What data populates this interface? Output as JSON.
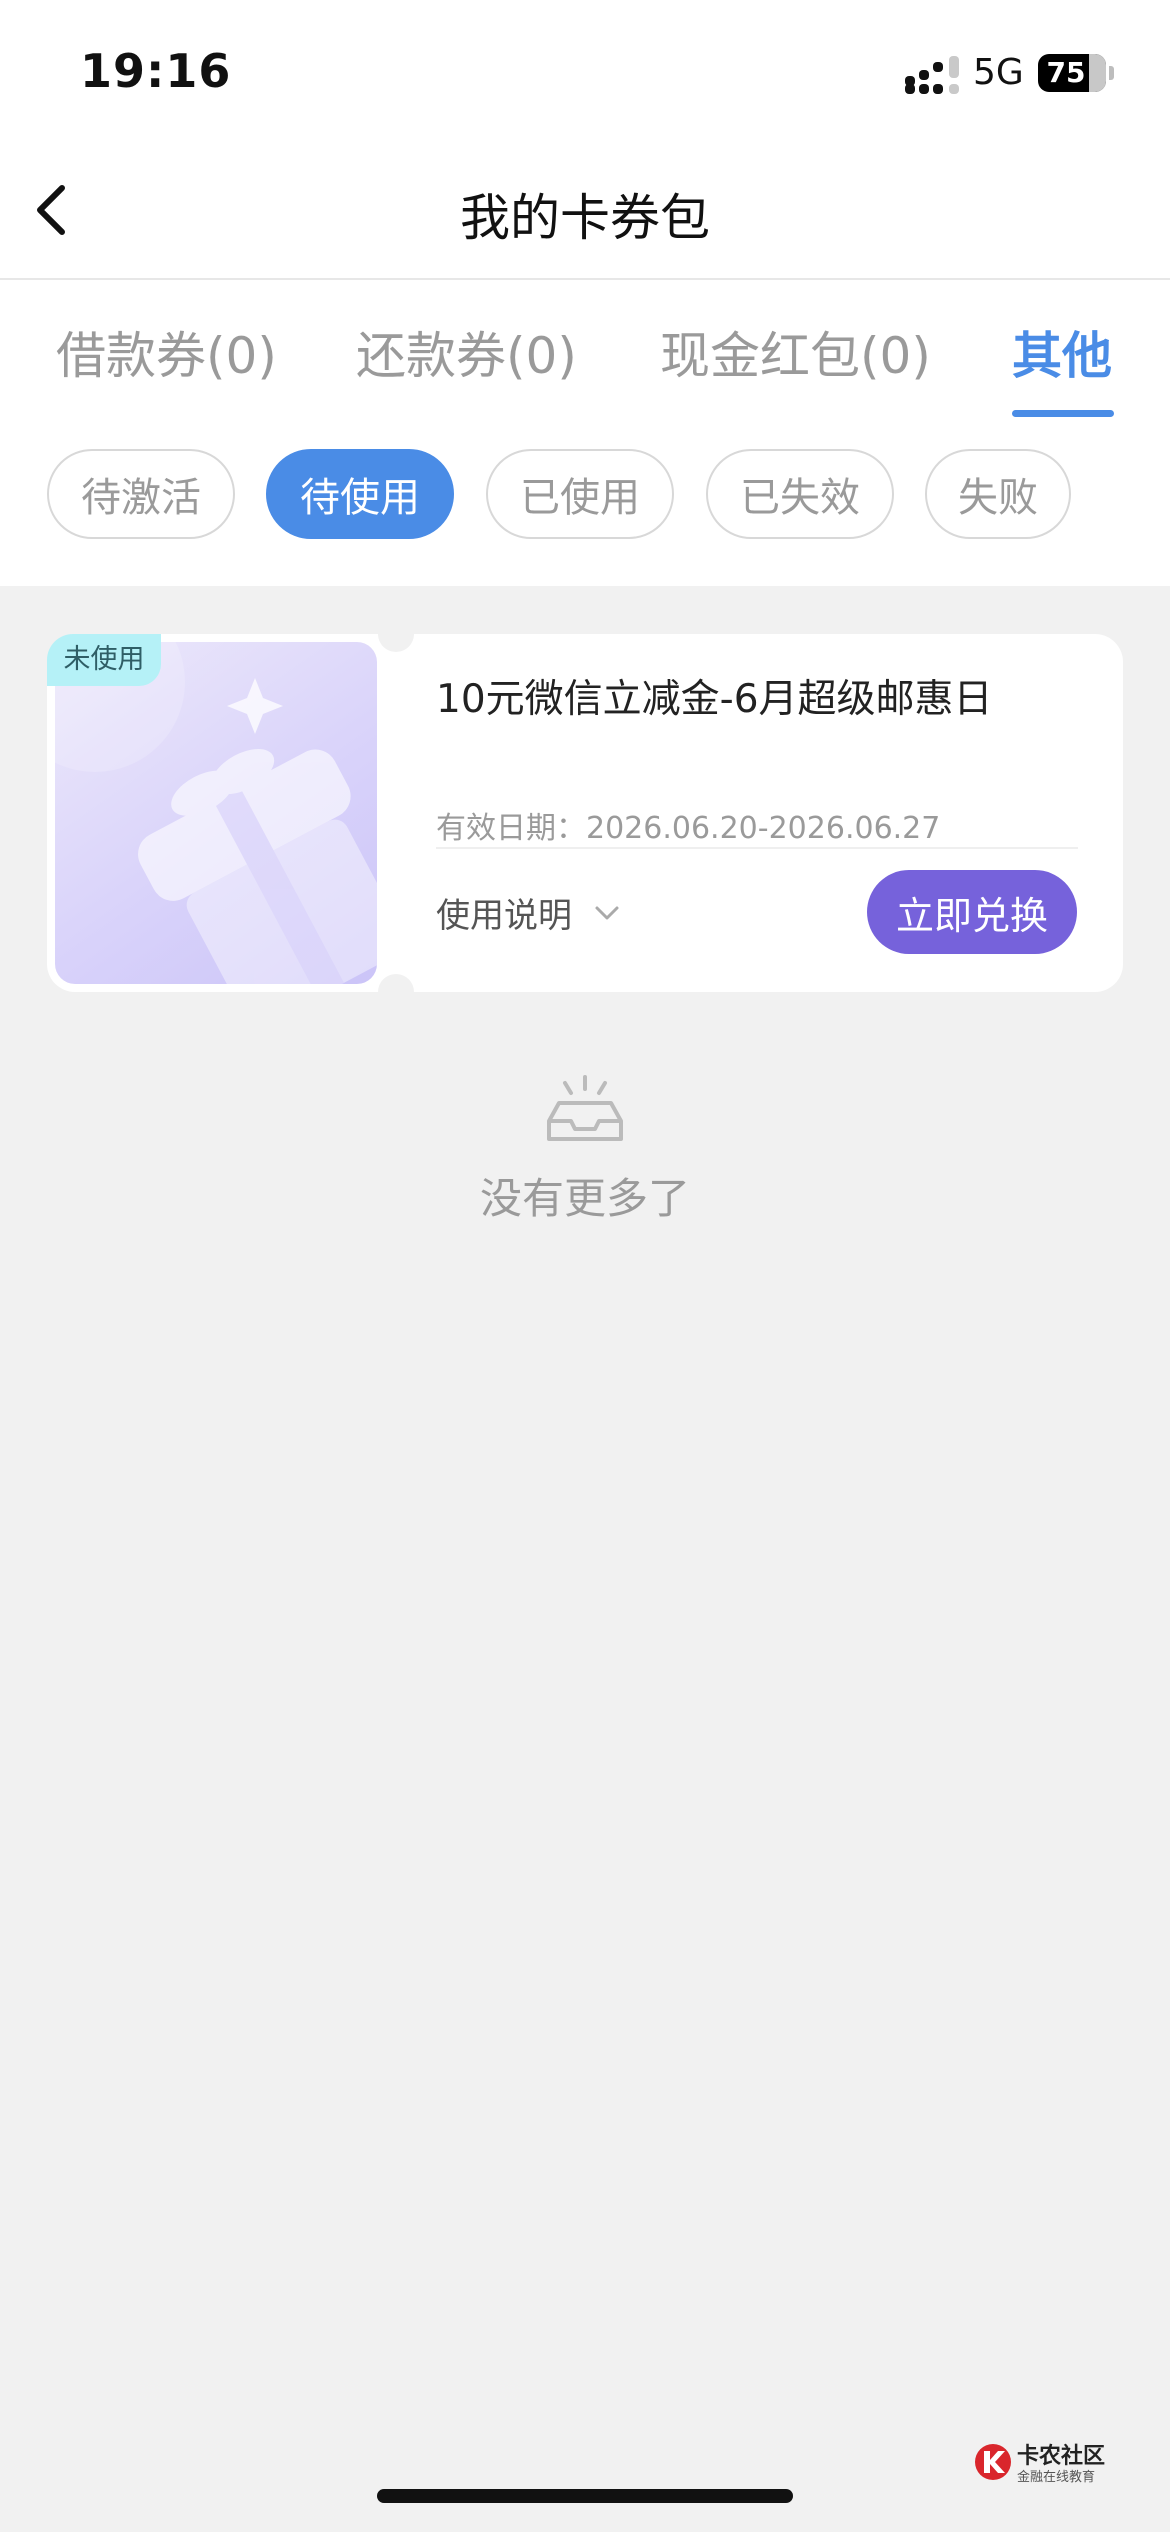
{
  "status_bar": {
    "time": "19:16",
    "network": "5G",
    "battery": "75"
  },
  "header": {
    "title": "我的卡券包"
  },
  "tabs": [
    {
      "label": "借款券(0)",
      "active": false
    },
    {
      "label": "还款券(0)",
      "active": false
    },
    {
      "label": "现金红包(0)",
      "active": false
    },
    {
      "label": "其他",
      "active": true
    }
  ],
  "filters": [
    {
      "label": "待激活",
      "active": false
    },
    {
      "label": "待使用",
      "active": true
    },
    {
      "label": "已使用",
      "active": false
    },
    {
      "label": "已失效",
      "active": false
    },
    {
      "label": "失败",
      "active": false
    }
  ],
  "coupon": {
    "badge": "未使用",
    "title": "10元微信立减金-6月超级邮惠日",
    "validity": "有效日期：2026.06.20-2026.06.27",
    "usage_label": "使用说明",
    "redeem_label": "立即兑换"
  },
  "empty_state": {
    "text": "没有更多了"
  },
  "watermark": {
    "name": "卡农社区",
    "tagline": "金融在线教育"
  },
  "colors": {
    "accent": "#4a8ce6",
    "redeem": "#7662db",
    "badge_bg": "#b5f1f7",
    "background": "#f1f1f1"
  },
  "icons": [
    "back-chevron-icon",
    "signal-icon",
    "battery-icon",
    "chevron-down-icon",
    "empty-tray-icon",
    "gift-illustration",
    "kanong-logo"
  ]
}
